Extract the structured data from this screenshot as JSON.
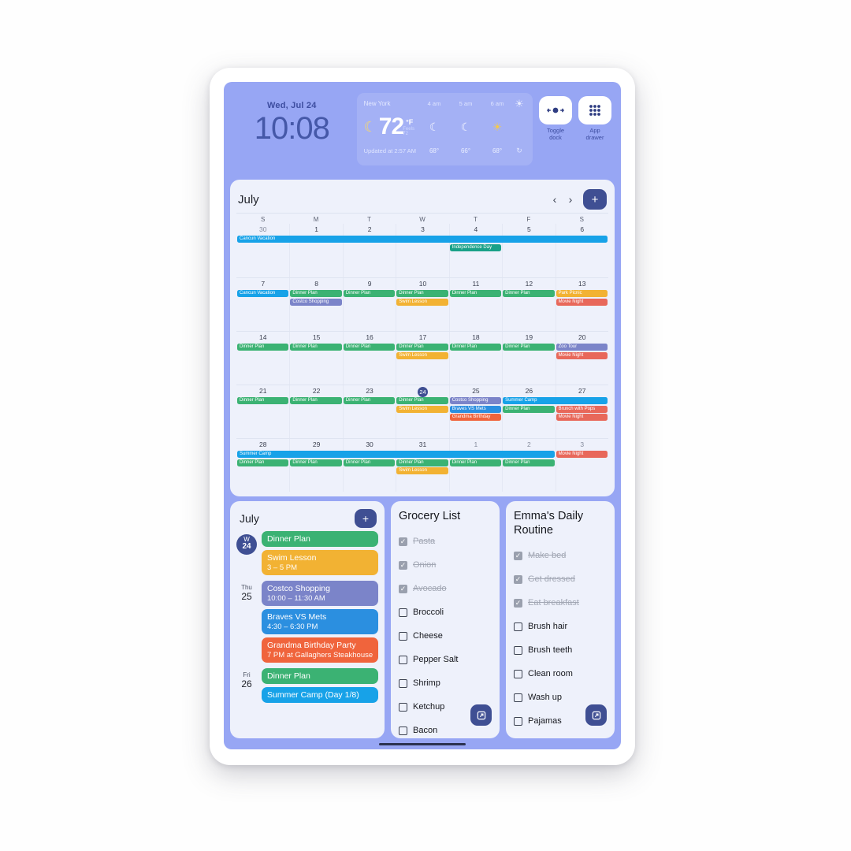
{
  "status": {
    "date": "Wed, Jul 24",
    "time": "10:08"
  },
  "weather": {
    "city": "New York",
    "temp": "72",
    "unit": "°F",
    "feels": "Feels 72",
    "now_icon": "moon-icon",
    "updated": "Updated at 2:57 AM",
    "refresh_icon": "refresh-icon",
    "sun_icon": "sun-icon",
    "hours": [
      {
        "label": "4 am",
        "icon": "moon-icon",
        "glyph": "☾",
        "temp": "68°"
      },
      {
        "label": "5 am",
        "icon": "moon-icon",
        "glyph": "☾",
        "temp": "66°"
      },
      {
        "label": "6 am",
        "icon": "sun-icon",
        "glyph": "☀",
        "temp": "68°"
      }
    ]
  },
  "topbuttons": [
    {
      "name": "toggle-dock",
      "label": "Toggle\ndock",
      "icon": "dock-icon"
    },
    {
      "name": "app-drawer",
      "label": "App\ndrawer",
      "icon": "grid-icon"
    }
  ],
  "calendar": {
    "title": "July",
    "prev_label": "‹",
    "next_label": "›",
    "add_label": "+",
    "dow": [
      "S",
      "M",
      "T",
      "W",
      "T",
      "F",
      "S"
    ],
    "today_index": 24,
    "weeks": [
      {
        "days": [
          {
            "n": "30",
            "muted": true
          },
          {
            "n": "1"
          },
          {
            "n": "2"
          },
          {
            "n": "3"
          },
          {
            "n": "4"
          },
          {
            "n": "5"
          },
          {
            "n": "6"
          }
        ],
        "events": [
          {
            "title": "Cancun Vacation",
            "start": 0,
            "span": 7,
            "row": 0,
            "color": "#17a2e8"
          },
          {
            "title": "Independence Day",
            "start": 4,
            "span": 1,
            "row": 1,
            "color": "#19a188"
          }
        ]
      },
      {
        "days": [
          {
            "n": "7"
          },
          {
            "n": "8"
          },
          {
            "n": "9"
          },
          {
            "n": "10"
          },
          {
            "n": "11"
          },
          {
            "n": "12"
          },
          {
            "n": "13"
          }
        ],
        "events": [
          {
            "title": "Cancun Vacation",
            "start": 0,
            "span": 1,
            "row": 0,
            "color": "#17a2e8"
          },
          {
            "title": "Dinner Plan",
            "start": 1,
            "span": 1,
            "row": 0,
            "color": "#3bb273"
          },
          {
            "title": "Dinner Plan",
            "start": 2,
            "span": 1,
            "row": 0,
            "color": "#3bb273"
          },
          {
            "title": "Dinner Plan",
            "start": 3,
            "span": 1,
            "row": 0,
            "color": "#3bb273"
          },
          {
            "title": "Dinner Plan",
            "start": 4,
            "span": 1,
            "row": 0,
            "color": "#3bb273"
          },
          {
            "title": "Dinner Plan",
            "start": 5,
            "span": 1,
            "row": 0,
            "color": "#3bb273"
          },
          {
            "title": "Park Picnic",
            "start": 6,
            "span": 1,
            "row": 0,
            "color": "#f2b233"
          },
          {
            "title": "Costco Shopping",
            "start": 1,
            "span": 1,
            "row": 1,
            "color": "#7b84c9"
          },
          {
            "title": "Swim Lesson",
            "start": 3,
            "span": 1,
            "row": 1,
            "color": "#f2b233"
          },
          {
            "title": "Movie Night",
            "start": 6,
            "span": 1,
            "row": 1,
            "color": "#e8685a"
          }
        ]
      },
      {
        "days": [
          {
            "n": "14"
          },
          {
            "n": "15"
          },
          {
            "n": "16"
          },
          {
            "n": "17"
          },
          {
            "n": "18"
          },
          {
            "n": "19"
          },
          {
            "n": "20"
          }
        ],
        "events": [
          {
            "title": "Dinner Plan",
            "start": 0,
            "span": 1,
            "row": 0,
            "color": "#3bb273"
          },
          {
            "title": "Dinner Plan",
            "start": 1,
            "span": 1,
            "row": 0,
            "color": "#3bb273"
          },
          {
            "title": "Dinner Plan",
            "start": 2,
            "span": 1,
            "row": 0,
            "color": "#3bb273"
          },
          {
            "title": "Dinner Plan",
            "start": 3,
            "span": 1,
            "row": 0,
            "color": "#3bb273"
          },
          {
            "title": "Dinner Plan",
            "start": 4,
            "span": 1,
            "row": 0,
            "color": "#3bb273"
          },
          {
            "title": "Dinner Plan",
            "start": 5,
            "span": 1,
            "row": 0,
            "color": "#3bb273"
          },
          {
            "title": "Zoo Tour",
            "start": 6,
            "span": 1,
            "row": 0,
            "color": "#7b84c9"
          },
          {
            "title": "Swim Lesson",
            "start": 3,
            "span": 1,
            "row": 1,
            "color": "#f2b233"
          },
          {
            "title": "Movie Night",
            "start": 6,
            "span": 1,
            "row": 1,
            "color": "#e8685a"
          }
        ]
      },
      {
        "days": [
          {
            "n": "21"
          },
          {
            "n": "22"
          },
          {
            "n": "23"
          },
          {
            "n": "24",
            "today": true
          },
          {
            "n": "25"
          },
          {
            "n": "26"
          },
          {
            "n": "27"
          }
        ],
        "events": [
          {
            "title": "Dinner Plan",
            "start": 0,
            "span": 1,
            "row": 0,
            "color": "#3bb273"
          },
          {
            "title": "Dinner Plan",
            "start": 1,
            "span": 1,
            "row": 0,
            "color": "#3bb273"
          },
          {
            "title": "Dinner Plan",
            "start": 2,
            "span": 1,
            "row": 0,
            "color": "#3bb273"
          },
          {
            "title": "Dinner Plan",
            "start": 3,
            "span": 1,
            "row": 0,
            "color": "#3bb273"
          },
          {
            "title": "Costco Shopping",
            "start": 4,
            "span": 1,
            "row": 0,
            "color": "#7b84c9"
          },
          {
            "title": "Summer Camp",
            "start": 5,
            "span": 2,
            "row": 0,
            "color": "#17a2e8"
          },
          {
            "title": "Swim Lesson",
            "start": 3,
            "span": 1,
            "row": 1,
            "color": "#f2b233"
          },
          {
            "title": "Braves VS Mets",
            "start": 4,
            "span": 1,
            "row": 1,
            "color": "#2b8fe0"
          },
          {
            "title": "Dinner Plan",
            "start": 5,
            "span": 1,
            "row": 1,
            "color": "#3bb273"
          },
          {
            "title": "Brunch with Pops",
            "start": 6,
            "span": 1,
            "row": 1,
            "color": "#e8685a"
          },
          {
            "title": "Grandma Birthday",
            "start": 4,
            "span": 1,
            "row": 2,
            "color": "#f0643c"
          },
          {
            "title": "Movie Night",
            "start": 6,
            "span": 1,
            "row": 2,
            "color": "#e8685a"
          }
        ]
      },
      {
        "days": [
          {
            "n": "28"
          },
          {
            "n": "29"
          },
          {
            "n": "30"
          },
          {
            "n": "31"
          },
          {
            "n": "1",
            "muted": true
          },
          {
            "n": "2",
            "muted": true
          },
          {
            "n": "3",
            "muted": true
          }
        ],
        "events": [
          {
            "title": "Summer Camp",
            "start": 0,
            "span": 6,
            "row": 0,
            "color": "#17a2e8"
          },
          {
            "title": "Movie Night",
            "start": 6,
            "span": 1,
            "row": 0,
            "color": "#e8685a"
          },
          {
            "title": "Dinner Plan",
            "start": 0,
            "span": 1,
            "row": 1,
            "color": "#3bb273"
          },
          {
            "title": "Dinner Plan",
            "start": 1,
            "span": 1,
            "row": 1,
            "color": "#3bb273"
          },
          {
            "title": "Dinner Plan",
            "start": 2,
            "span": 1,
            "row": 1,
            "color": "#3bb273"
          },
          {
            "title": "Dinner Plan",
            "start": 3,
            "span": 1,
            "row": 1,
            "color": "#3bb273"
          },
          {
            "title": "Dinner Plan",
            "start": 4,
            "span": 1,
            "row": 1,
            "color": "#3bb273"
          },
          {
            "title": "Dinner Plan",
            "start": 5,
            "span": 1,
            "row": 1,
            "color": "#3bb273"
          },
          {
            "title": "Swim Lesson",
            "start": 3,
            "span": 1,
            "row": 2,
            "color": "#f2b233"
          }
        ]
      }
    ]
  },
  "agenda": {
    "title": "July",
    "add_label": "+",
    "groups": [
      {
        "dow": "W",
        "day": "24",
        "today": true,
        "events": [
          {
            "title": "Dinner Plan",
            "time": "",
            "color": "#3bb273"
          },
          {
            "title": "Swim Lesson",
            "time": "3 – 5 PM",
            "color": "#f2b233"
          }
        ]
      },
      {
        "dow": "Thu",
        "day": "25",
        "today": false,
        "events": [
          {
            "title": "Costco Shopping",
            "time": "10:00 – 11:30 AM",
            "color": "#7b84c9"
          },
          {
            "title": "Braves VS Mets",
            "time": "4:30 – 6:30 PM",
            "color": "#2b8fe0"
          },
          {
            "title": "Grandma Birthday Party",
            "time": "7 PM at Gallaghers Steakhouse",
            "color": "#f0643c"
          }
        ]
      },
      {
        "dow": "Fri",
        "day": "26",
        "today": false,
        "events": [
          {
            "title": "Dinner Plan",
            "time": "",
            "color": "#3bb273"
          },
          {
            "title": "Summer Camp (Day 1/8)",
            "time": "",
            "color": "#17a2e8"
          }
        ]
      }
    ]
  },
  "grocery": {
    "title": "Grocery List",
    "open_icon": "external-link-icon",
    "items": [
      {
        "label": "Pasta",
        "done": true
      },
      {
        "label": "Onion",
        "done": true
      },
      {
        "label": "Avocado",
        "done": true
      },
      {
        "label": "Broccoli",
        "done": false
      },
      {
        "label": "Cheese",
        "done": false
      },
      {
        "label": "Pepper Salt",
        "done": false
      },
      {
        "label": "Shrimp",
        "done": false
      },
      {
        "label": "Ketchup",
        "done": false
      },
      {
        "label": "Bacon",
        "done": false
      }
    ]
  },
  "routine": {
    "title": "Emma's Daily Routine",
    "open_icon": "external-link-icon",
    "items": [
      {
        "label": "Make bed",
        "done": true
      },
      {
        "label": "Get dressed",
        "done": true
      },
      {
        "label": "Eat breakfast",
        "done": true
      },
      {
        "label": "Brush hair",
        "done": false
      },
      {
        "label": "Brush teeth",
        "done": false
      },
      {
        "label": "Clean room",
        "done": false
      },
      {
        "label": "Wash up",
        "done": false
      },
      {
        "label": "Pajamas",
        "done": false
      }
    ]
  },
  "colors": {
    "wallpaper": "#97a6f4",
    "accent": "#3f4f93",
    "card": "#eef1fb"
  }
}
